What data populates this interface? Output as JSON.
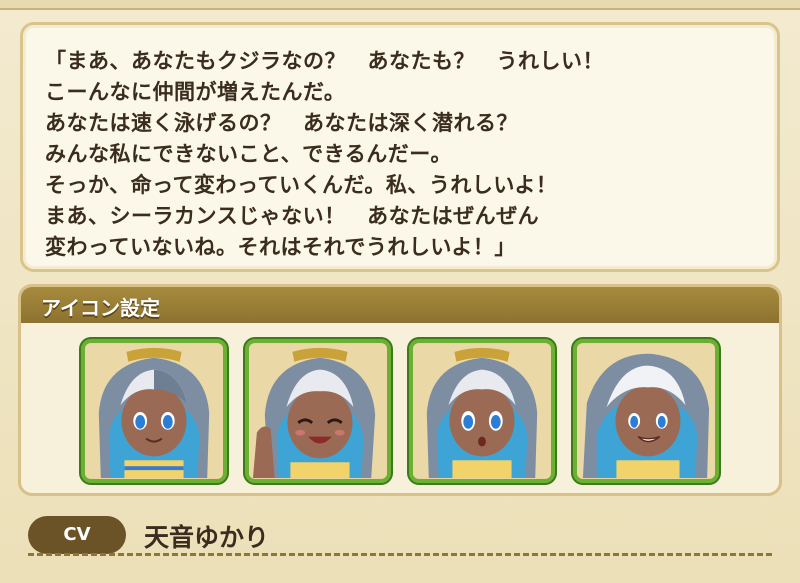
{
  "dialog": {
    "lines": [
      "「まあ、あなたもクジラなの？　あなたも？　うれしい！",
      "こーんなに仲間が増えたんだ。",
      "あなたは速く泳げるの？　あなたは深く潜れる？",
      "みんな私にできないこと、できるんだー。",
      "そっか、命って変わっていくんだ。私、うれしいよ！",
      "まあ、シーラカンスじゃない！　あなたはぜんぜん",
      "変わっていないね。それはそれでうれしいよ！」"
    ]
  },
  "icon_settings": {
    "title": "アイコン設定",
    "icons": [
      {
        "expression": "neutral",
        "icon": "character-portrait-smile"
      },
      {
        "expression": "happy",
        "icon": "character-portrait-wink"
      },
      {
        "expression": "surprised",
        "icon": "character-portrait-surprised"
      },
      {
        "expression": "smug",
        "icon": "character-portrait-grin"
      }
    ]
  },
  "cv": {
    "label": "CV",
    "name": "天音ゆかり"
  },
  "colors": {
    "border_green": "#6cb033",
    "header_gold": "#a68a3e",
    "text_dark": "#3a2c1e"
  }
}
